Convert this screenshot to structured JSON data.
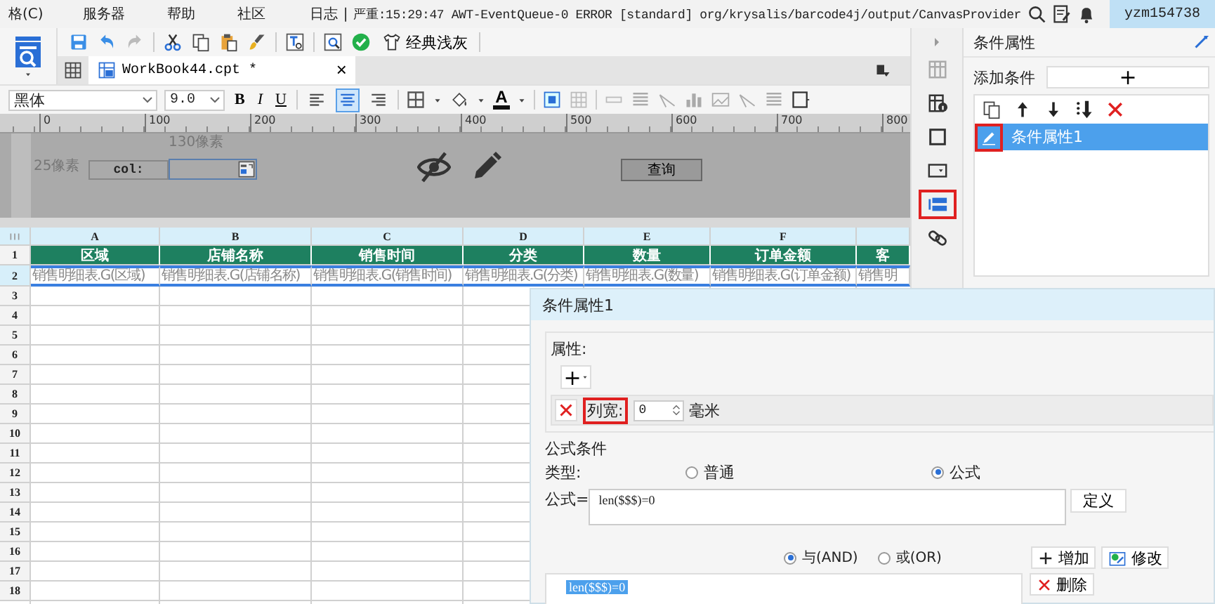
{
  "menu_bar": {
    "items": [
      "格(C)",
      "服务器",
      "帮助",
      "社区"
    ],
    "log_label": "日志",
    "log_separator": "|",
    "log_message": "严重:15:29:47 AWT-EventQueue-0 ERROR [standard] org/krysalis/barcode4j/output/CanvasProvider",
    "user": "yzm154738"
  },
  "toolbar": {
    "theme_button": "经典浅灰"
  },
  "tabs": [
    {
      "label": "WorkBook44.cpt *",
      "selected": true,
      "close": "×"
    }
  ],
  "format_bar": {
    "font": "黑体",
    "size": "9.0",
    "bold": "B",
    "italic": "I",
    "underline": "U",
    "font_color": "A",
    "align_buttons": [
      {
        "selected": false
      },
      {
        "selected": true
      },
      {
        "selected": false
      }
    ]
  },
  "ruler": {
    "ticks": [
      "0",
      "100",
      "200",
      "300",
      "400",
      "500",
      "600",
      "700",
      "800"
    ]
  },
  "canvas": {
    "width_label": "130像素",
    "height_label": "25像素",
    "field_label": "col:",
    "query_button": "查询"
  },
  "sheet": {
    "row_numbers": [
      "1",
      "2",
      "3",
      "4",
      "5",
      "6",
      "7",
      "8",
      "9",
      "10",
      "11",
      "12",
      "13",
      "14",
      "15",
      "16",
      "17",
      "18"
    ],
    "columns": [
      {
        "letter": "A",
        "header": "区域",
        "value": "销售明细表.G(区域)"
      },
      {
        "letter": "B",
        "header": "店铺名称",
        "value": "销售明细表.G(店铺名称)"
      },
      {
        "letter": "C",
        "header": "销售时间",
        "value": "销售明细表.G(销售时间)"
      },
      {
        "letter": "D",
        "header": "分类",
        "value": "销售明细表.G(分类)"
      },
      {
        "letter": "E",
        "header": "数量",
        "value": "销售明细表.G(数量)"
      },
      {
        "letter": "F",
        "header": "订单金额",
        "value": "销售明细表.G(订单金额)"
      },
      {
        "header": "客",
        "value": "销售明"
      }
    ]
  },
  "side_strip": {
    "icons": [
      {
        "kind": "grid",
        "annotated": false
      },
      {
        "kind": "info",
        "annotated": false
      },
      {
        "kind": "frame",
        "annotated": false
      },
      {
        "kind": "dropdown",
        "annotated": false
      },
      {
        "kind": "condition",
        "annotated": true
      },
      {
        "kind": "link",
        "annotated": false
      }
    ]
  },
  "right_panel": {
    "title": "条件属性",
    "add_label": "添加条件",
    "add_button": "+",
    "conditions": [
      {
        "label": "条件属性1",
        "selected": true,
        "annotated": true
      }
    ]
  },
  "dialog": {
    "title": "条件属性1",
    "property_group": {
      "label": "属性:",
      "add_button": "+",
      "property": {
        "label": "列宽:",
        "annotated": true,
        "value": "0",
        "unit": "毫米"
      }
    },
    "formula_group": {
      "label": "公式条件",
      "type_label": "类型:",
      "types": [
        {
          "label": "普通",
          "selected": false
        },
        {
          "label": "公式",
          "selected": true
        }
      ],
      "formula_label": "公式=",
      "formula": "len($$$)=0",
      "define_button": "定义",
      "logic": [
        {
          "label": "与(AND)",
          "selected": true
        },
        {
          "label": "或(OR)",
          "selected": false
        }
      ],
      "add_button": "增加",
      "modify_button": "修改",
      "conditions": [
        {
          "label": "len($$$)=0",
          "selected": true
        }
      ],
      "delete_button": "删除"
    }
  }
}
